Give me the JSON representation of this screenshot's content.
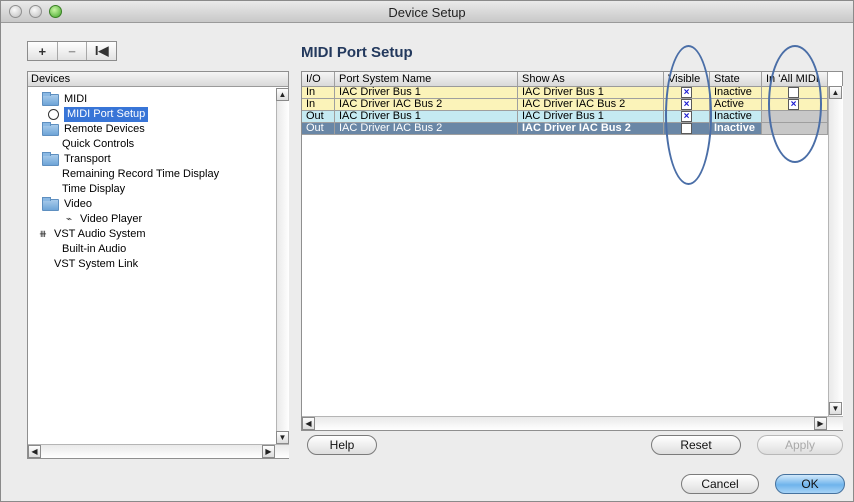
{
  "window": {
    "title": "Device Setup"
  },
  "toolbar": {
    "add": "+",
    "remove": "−",
    "reset": "I◀"
  },
  "page_heading": "MIDI Port Setup",
  "devices": {
    "header": "Devices",
    "items": [
      {
        "label": "MIDI",
        "icon": "folder-icon",
        "indent": 1
      },
      {
        "label": "MIDI Port Setup",
        "icon": "midi-port-icon",
        "indent": 2,
        "selected": true
      },
      {
        "label": "Remote Devices",
        "icon": "folder-icon",
        "indent": 1
      },
      {
        "label": "Quick Controls",
        "icon": "",
        "indent": 1
      },
      {
        "label": "Transport",
        "icon": "folder-icon",
        "indent": 1
      },
      {
        "label": "Remaining Record Time Display",
        "icon": "",
        "indent": 1
      },
      {
        "label": "Time Display",
        "icon": "",
        "indent": 1
      },
      {
        "label": "Video",
        "icon": "folder-icon",
        "indent": 1
      },
      {
        "label": "Video Player",
        "icon": "video-player-icon",
        "indent": 2
      },
      {
        "label": "VST Audio System",
        "icon": "vst-audio-icon",
        "indent": 0
      },
      {
        "label": "Built-in Audio",
        "icon": "",
        "indent": 1
      },
      {
        "label": "VST System Link",
        "icon": "",
        "indent": 0
      }
    ]
  },
  "table": {
    "columns": [
      "I/O",
      "Port System Name",
      "Show As",
      "Visible",
      "State",
      "In 'All MIDI"
    ],
    "rows": [
      {
        "io": "In",
        "port": "IAC Driver Bus 1",
        "show_as": "IAC Driver Bus 1",
        "visible": true,
        "state": "Inactive",
        "in_all_midi": false
      },
      {
        "io": "In",
        "port": "IAC Driver IAC Bus 2",
        "show_as": "IAC Driver IAC Bus 2",
        "visible": true,
        "state": "Active",
        "in_all_midi": true
      },
      {
        "io": "Out",
        "port": "IAC Driver Bus 1",
        "show_as": "IAC Driver Bus 1",
        "visible": true,
        "state": "Inactive",
        "in_all_midi": null
      },
      {
        "io": "Out",
        "port": "IAC Driver IAC Bus 2",
        "show_as": "IAC Driver IAC Bus 2",
        "visible": false,
        "state": "Inactive",
        "in_all_midi": null,
        "selected": true
      }
    ]
  },
  "buttons": {
    "help": "Help",
    "reset": "Reset",
    "apply": "Apply",
    "cancel": "Cancel",
    "ok": "OK"
  },
  "colors": {
    "in_row": "#fbf3b9",
    "out_row": "#c5eaf2",
    "selected_row": "#6a87a6",
    "heading": "#23395d",
    "annotation": "#4a6ea7"
  }
}
